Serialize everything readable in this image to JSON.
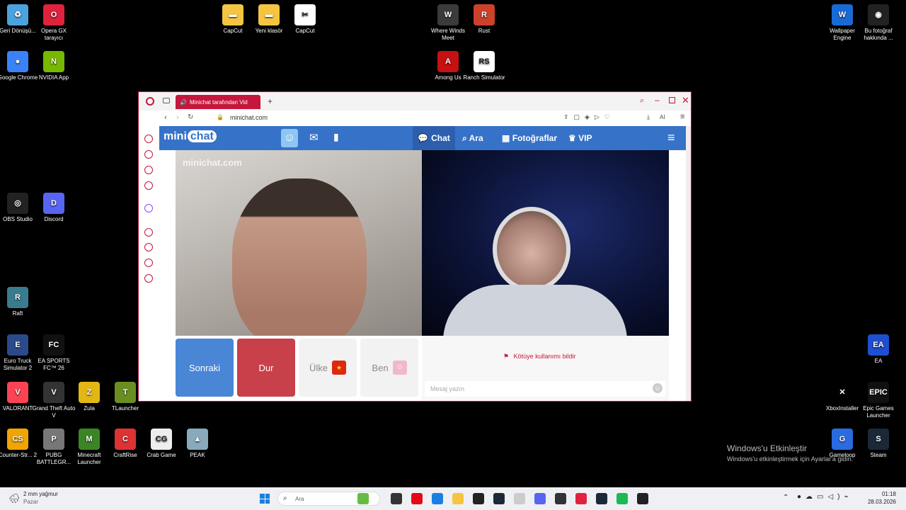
{
  "desktop": {
    "icons": [
      {
        "label": "Geri Dönüşü...",
        "color": "#4aa3df",
        "glyph": "♻"
      },
      {
        "label": "Opera GX tarayıcı",
        "color": "#e0223d",
        "glyph": "O"
      },
      {
        "label": "Google Chrome",
        "color": "#3b82f6",
        "glyph": "●"
      },
      {
        "label": "NVIDIA App",
        "color": "#76b900",
        "glyph": "N"
      },
      {
        "label": "OBS Studio",
        "color": "#222",
        "glyph": "◎"
      },
      {
        "label": "Discord",
        "color": "#5865f2",
        "glyph": "D"
      },
      {
        "label": "Raft",
        "color": "#3a7c8f",
        "glyph": "R"
      },
      {
        "label": "Euro Truck Simulator 2",
        "color": "#2a4a8a",
        "glyph": "E"
      },
      {
        "label": "EA SPORTS FC™ 26",
        "color": "#111",
        "glyph": "FC"
      },
      {
        "label": "VALORANT",
        "color": "#fa4454",
        "glyph": "V"
      },
      {
        "label": "Grand Theft Auto V",
        "color": "#333",
        "glyph": "V"
      },
      {
        "label": "Zula",
        "color": "#e2b714",
        "glyph": "Z"
      },
      {
        "label": "TLauncher",
        "color": "#6b8e23",
        "glyph": "T"
      },
      {
        "label": "Counter-Str... 2",
        "color": "#f0a500",
        "glyph": "CS"
      },
      {
        "label": "PUBG BATTLEGR...",
        "color": "#777",
        "glyph": "P"
      },
      {
        "label": "Minecraft Launcher",
        "color": "#3c8527",
        "glyph": "M"
      },
      {
        "label": "CraftRise",
        "color": "#d33",
        "glyph": "C"
      },
      {
        "label": "Crab Game",
        "color": "#eee",
        "glyph": "CG"
      },
      {
        "label": "PEAK",
        "color": "#8ab",
        "glyph": "▲"
      },
      {
        "label": "CapCut",
        "color": "#f5c542",
        "glyph": "▬"
      },
      {
        "label": "Yeni klasör",
        "color": "#f5c542",
        "glyph": "▬"
      },
      {
        "label": "CapCut",
        "color": "#fff",
        "glyph": "✂"
      },
      {
        "label": "Where Winds Meet",
        "color": "#3b3b3b",
        "glyph": "W"
      },
      {
        "label": "Rust",
        "color": "#cd412b",
        "glyph": "R"
      },
      {
        "label": "Among Us",
        "color": "#c51111",
        "glyph": "A"
      },
      {
        "label": "Ranch Simulator",
        "color": "#fff",
        "glyph": "RS"
      },
      {
        "label": "Wallpaper Engine",
        "color": "#1a6ad6",
        "glyph": "W"
      },
      {
        "label": "Bu fotoğraf hakkında ...",
        "color": "#222",
        "glyph": "◉"
      },
      {
        "label": "EA",
        "color": "#1e4fd0",
        "glyph": "EA"
      },
      {
        "label": "XboxInstaller",
        "color": "#000",
        "glyph": "✕"
      },
      {
        "label": "Epic Games Launcher",
        "color": "#111",
        "glyph": "EPIC"
      },
      {
        "label": "Gameloop",
        "color": "#2b6be0",
        "glyph": "G"
      },
      {
        "label": "Steam",
        "color": "#1b2838",
        "glyph": "S"
      }
    ],
    "activation_title": "Windows'u Etkinleştir",
    "activation_sub": "Windows'u etkinleştirmek için Ayarlar'a gidin."
  },
  "browser": {
    "tab_title": "Minichat tarafından Vid",
    "url": "minichat.com",
    "accent": "#c4173b"
  },
  "minichat": {
    "logo_left": "mini",
    "logo_right": "chat",
    "nav": {
      "chat": "Chat",
      "search": "Ara",
      "photos": "Fotoğraflar",
      "vip": "VIP"
    },
    "watermark": "minichat.com",
    "buttons": {
      "next": "Sonraki",
      "stop": "Dur",
      "country": "Ülke",
      "me": "Ben"
    },
    "report": "Kötüye kullanımı bildir",
    "message_placeholder": "Mesaj yazın",
    "colors": {
      "nav": "#3672c8",
      "next": "#4a86d6",
      "stop": "#c8404a"
    }
  },
  "taskbar": {
    "weather_temp": "2 mm yağmur",
    "weather_day": "Pazar",
    "search_placeholder": "Ara",
    "time": "01:18",
    "date": "28.03.2026"
  }
}
